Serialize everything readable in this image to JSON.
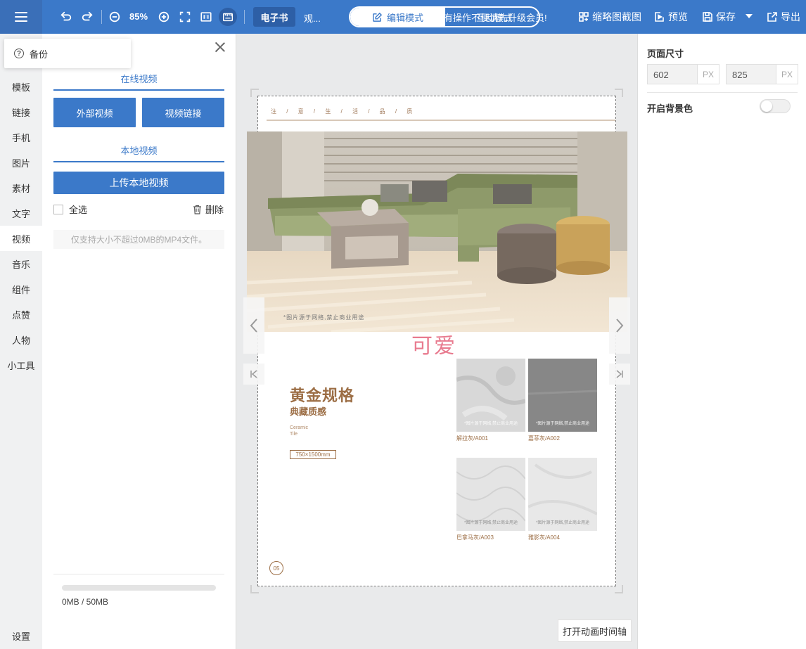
{
  "toolbar": {
    "zoom": "85%",
    "tabs": [
      "电子书",
      "观..."
    ],
    "mode_edit": "编辑模式",
    "mode_interactive": "互动模式",
    "marquee": "有操作不便请先升级会员!",
    "thumbnail_label": "缩略图截图",
    "preview_label": "预览",
    "save_label": "保存",
    "export_label": "导出",
    "icons": [
      "menu-icon",
      "undo-icon",
      "redo-icon",
      "zoom-out-icon",
      "zoom-in-icon",
      "fullscreen-icon",
      "actual-size-icon",
      "ruler-icon"
    ],
    "colors": {
      "bar": "#3b79c9",
      "dark": "#2d5fa6"
    }
  },
  "leftnav": {
    "items": [
      "模板",
      "链接",
      "手机",
      "图片",
      "素材",
      "文字",
      "视频",
      "音乐",
      "组件",
      "点赞",
      "人物",
      "小工具"
    ],
    "active": "视频",
    "bottom": "设置"
  },
  "panel": {
    "backup_label": "备份",
    "online_title": "在线视频",
    "external_btn": "外部视频",
    "link_btn": "视频链接",
    "local_title": "本地视频",
    "upload_btn": "上传本地视频",
    "select_all": "全选",
    "delete_label": "删除",
    "hint": "仅支持大小不超过0MB的MP4文件。",
    "storage_text": "0MB / 50MB",
    "storage_fraction": 0
  },
  "page": {
    "header": "注 / 意 / 生 / 活 / 品 / 质",
    "photo_caption": "*图片源于网络,禁止商业用途",
    "sticker": "可爱",
    "title": "黄金规格",
    "subtitle": "典藏质感",
    "en_line1": "Ceramic",
    "en_line2": "Tile",
    "size": "750×1500mm",
    "tile_caption": "*图片源于网络,禁止商业用途",
    "tiles": [
      "解拉灰/A001",
      "嘉菲灰/A002",
      "巴拿马灰/A003",
      "雅影灰/A004"
    ],
    "page_number": "05"
  },
  "canvas": {
    "timeline_btn": "打开动画时间轴"
  },
  "rightpanel": {
    "size_title": "页面尺寸",
    "width": "602",
    "height": "825",
    "unit": "PX",
    "bg_label": "开启背景色",
    "bg_enabled": false
  }
}
